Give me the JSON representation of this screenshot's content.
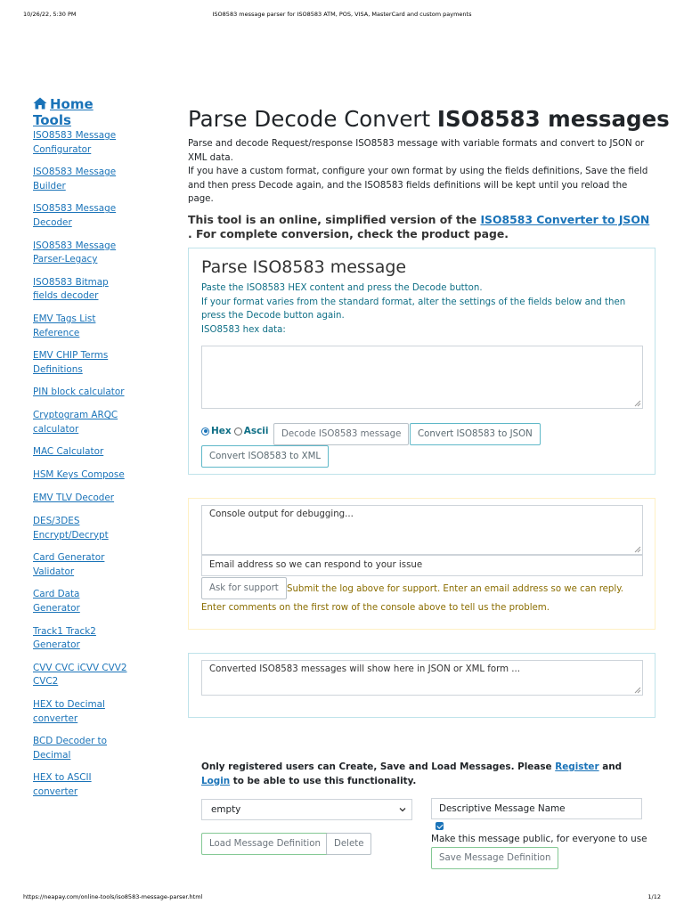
{
  "print_header": {
    "date": "10/26/22, 5:30 PM",
    "title": "ISO8583 message parser for ISO8583 ATM, POS, VISA, MasterCard and custom payments"
  },
  "print_footer": {
    "url": "https://neapay.com/online-tools/iso8583-message-parser.html",
    "page": "1/12"
  },
  "sidebar": {
    "home_label": "Home",
    "tools_label": "Tools",
    "items": [
      {
        "line1": "ISO8583 Message",
        "line2": "Configurator"
      },
      {
        "line1": "ISO8583 Message",
        "line2": "Builder"
      },
      {
        "line1": "ISO8583 Message",
        "line2": "Decoder"
      },
      {
        "line1": "ISO8583 Message",
        "line2": "Parser-Legacy"
      },
      {
        "line1": "ISO8583 Bitmap",
        "line2": "fields decoder"
      },
      {
        "line1": "EMV Tags List",
        "line2": "Reference"
      },
      {
        "line1": "EMV CHIP Terms",
        "line2": "Definitions"
      },
      {
        "line1": "PIN block calculator",
        "line2": ""
      },
      {
        "line1": "Cryptogram ARQC",
        "line2": "calculator"
      },
      {
        "line1": "MAC Calculator",
        "line2": ""
      },
      {
        "line1": "HSM Keys Compose",
        "line2": ""
      },
      {
        "line1": "EMV TLV Decoder",
        "line2": ""
      },
      {
        "line1": "DES/3DES",
        "line2": "Encrypt/Decrypt"
      },
      {
        "line1": "Card Generator",
        "line2": "Validator"
      },
      {
        "line1": "Card Data",
        "line2": "Generator"
      },
      {
        "line1": "Track1 Track2",
        "line2": "Generator"
      },
      {
        "line1": "CVV CVC iCVV CVV2",
        "line2": "CVC2"
      },
      {
        "line1": "HEX to Decimal",
        "line2": "converter"
      },
      {
        "line1": "BCD Decoder to",
        "line2": "Decimal"
      },
      {
        "line1": "HEX to ASCII",
        "line2": "converter"
      }
    ]
  },
  "main": {
    "title_normal": "Parse Decode Convert ",
    "title_bold": "ISO8583 messages",
    "intro_1": "Parse and decode Request/response ISO8583 message with variable formats and convert to JSON or XML data.",
    "intro_2": "If you have a custom format, configure your own format by using the fields definitions, Save the field and then press Decode again, and the ISO8583 fields definitions will be kept until you reload the page.",
    "note_before": "This tool is an online, simplified version of the ",
    "note_link": "ISO8583 Converter to JSON",
    "note_after": " . For complete conversion, check the product page."
  },
  "parse_card": {
    "heading": "Parse ISO8583 message",
    "help_1": "Paste the ISO8583 HEX content and press the Decode button.",
    "help_2": "If your format varies from the standard format, alter the settings of the fields below and then press the Decode button again.",
    "help_3": "ISO8583 hex data:",
    "hex_value": "",
    "radio_hex": "Hex",
    "radio_ascii": "Ascii",
    "selected_format": "Hex",
    "decode_button": "Decode ISO8583 message",
    "json_button": "Convert ISO8583 to JSON",
    "xml_button": "Convert ISO8583 to XML"
  },
  "console_card": {
    "console_placeholder": "Console output for debugging...",
    "email_placeholder": "Email address so we can respond to your issue",
    "support_button": "Ask for support",
    "support_text": "Submit the log above for support. Enter an email address so we can reply. Enter comments on the first row of the console above to tell us the problem."
  },
  "converted_card": {
    "output_placeholder": "Converted ISO8583 messages will show here in JSON or XML form ..."
  },
  "messages": {
    "notice_before": "Only registered users can Create, Save and Load Messages. Please ",
    "register_link": "Register",
    "notice_and": " and ",
    "login_link": "Login",
    "notice_after": " to be able to use this functionality.",
    "select_value": "empty",
    "name_value": "Descriptive Message Name",
    "public_checked": true,
    "public_label": "Make this message public, for everyone to use",
    "load_button": "Load Message Definition",
    "delete_button": "Delete",
    "save_button": "Save Message Definition"
  },
  "colors": {
    "link": "#1a73b8",
    "info_border": "#bfe3ea",
    "warning_border": "#fff0c4",
    "info_text": "#0f6f86",
    "warning_text": "#8a6d00"
  }
}
